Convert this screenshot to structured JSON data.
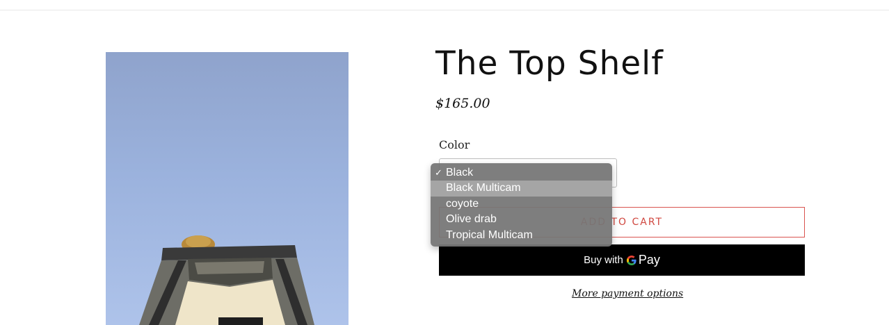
{
  "product": {
    "title": "The Top Shelf",
    "price": "$165.00",
    "color_label": "Color",
    "selected_color": "Black"
  },
  "dropdown": {
    "options": [
      {
        "label": "Black",
        "checked": true
      },
      {
        "label": "Black Multicam",
        "highlighted": true
      },
      {
        "label": "coyote"
      },
      {
        "label": "Olive drab"
      },
      {
        "label": "Tropical Multicam"
      }
    ],
    "check_glyph": "✓"
  },
  "buttons": {
    "add_to_cart_label": "ADD TO CART",
    "add_to_cart_visible_fragment": "TO CART",
    "buy_with": "Buy with",
    "g_letter": "G",
    "pay": "Pay",
    "more_payment_options": "More payment options"
  },
  "image": {
    "icon": "product-photo-rooftop-tent"
  },
  "colors": {
    "accent": "#d0473f",
    "button_black": "#000000",
    "dropdown_bg": "#767676",
    "dropdown_highlight": "#a5a5a5",
    "sky": "#9bb2dd"
  }
}
